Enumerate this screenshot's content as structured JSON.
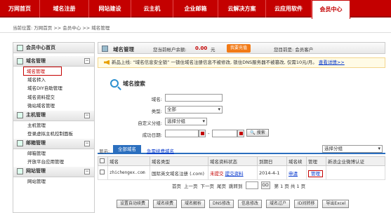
{
  "nav": [
    "万网首页",
    "域名注册",
    "网站建设",
    "云主机",
    "企业邮箱",
    "云解决方案",
    "云应用软件",
    "会员中心"
  ],
  "breadcrumb": "当前位置: 万网首页 >> 会员中心 >> 域名管理",
  "sidebar": {
    "home": "会员中心首页",
    "groups": [
      {
        "title": "域名管理",
        "items": [
          "域名管理",
          "域名转入",
          "域名DIY自助管理",
          "域名资料提交",
          "微站域名管理"
        ]
      },
      {
        "title": "主机管理",
        "items": [
          "主机管理",
          "登录虚拟主机控制面板"
        ]
      },
      {
        "title": "邮箱管理",
        "items": [
          "邮箱管理",
          "开放平台应用管理"
        ]
      },
      {
        "title": "网站管理",
        "items": [
          "网站管理"
        ]
      }
    ]
  },
  "header": {
    "title": "域名管理",
    "balance_label": "您当前帐户余额:",
    "balance": "0.00",
    "unit": "元",
    "recharge": "我要充值",
    "identity": "您目前是: 会员客户"
  },
  "notice": {
    "text": "新品上线: “域名信息安全锁” 一锁住域名注册信息不被修改, 锁住DNS服务器不被篡改, 仅需10元/月。",
    "link": "查看详情>>"
  },
  "search": {
    "title": "域名搜索",
    "domain_label": "域名:",
    "type_label": "类型:",
    "type_value": "全部",
    "group_label": "自定义分组:",
    "group_value": "选择分组",
    "date_label": "成功日期:",
    "date_sep": "-",
    "button": "搜索"
  },
  "tabs": {
    "show_label": "显示:",
    "all": "全部域名",
    "expiring": "急需续费域名",
    "group_select": "选择分组"
  },
  "table": {
    "headers": [
      "域名",
      "域名类型",
      "域名资料状态",
      "到期日",
      "域名续",
      "管理",
      "新浪企业微博认证"
    ],
    "rows": [
      {
        "domain": "zhichengex.com",
        "type": "国际英文域名注册 (.com)",
        "status": "未提交",
        "status_link": "提交资料",
        "expire": "2014-4-1",
        "renew": "申请",
        "manage": "管理",
        "weibo": ""
      }
    ]
  },
  "pager": {
    "first": "首页",
    "prev": "上一页",
    "next": "下一页",
    "last": "尾页",
    "jump": "跳转到",
    "go": "GO",
    "info": "第 1 页 共 1 页"
  },
  "actions": [
    "设置自动续费",
    "域名续费",
    "域名解析",
    "DNS修改",
    "信息修改",
    "域名过户",
    "ID间转移",
    "导出Excel"
  ]
}
